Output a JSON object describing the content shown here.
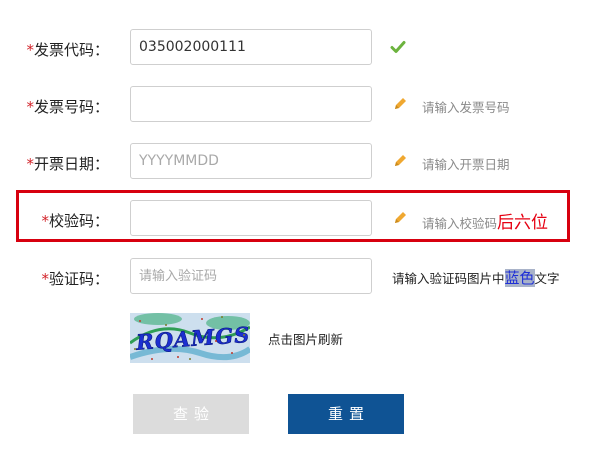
{
  "form": {
    "invoice_code": {
      "required_mark": "*",
      "label": "发票代码：",
      "value": "035002000111",
      "status": "valid"
    },
    "invoice_number": {
      "required_mark": "*",
      "label": "发票号码：",
      "value": "",
      "hint": "请输入发票号码"
    },
    "invoice_date": {
      "required_mark": "*",
      "label": "开票日期：",
      "placeholder": "YYYYMMDD",
      "hint": "请输入开票日期"
    },
    "check_code": {
      "required_mark": "*",
      "label": "校验码：",
      "value": "",
      "hint": "请输入校验码",
      "hint_emphasis": "后六位"
    },
    "captcha": {
      "required_mark": "*",
      "label": "验证码：",
      "placeholder": "请输入验证码",
      "hint_prefix": "请输入验证码图片中",
      "hint_color_word": "蓝色",
      "hint_suffix": "文字",
      "image_text": "RQAMGS",
      "refresh_text": "点击图片刷新"
    }
  },
  "buttons": {
    "query_label": "查验",
    "reset_label": "重置"
  },
  "colors": {
    "required_star": "#d2232a",
    "highlight_border": "#d7000f",
    "emphasis_red": "#e60012",
    "reset_button": "#0f5394",
    "query_button_disabled": "#dcdcdc",
    "check_icon": "#6cb33e",
    "pencil_icon": "#f0a830"
  },
  "icons": {
    "valid": "check-icon",
    "hint": "pencil-icon"
  }
}
